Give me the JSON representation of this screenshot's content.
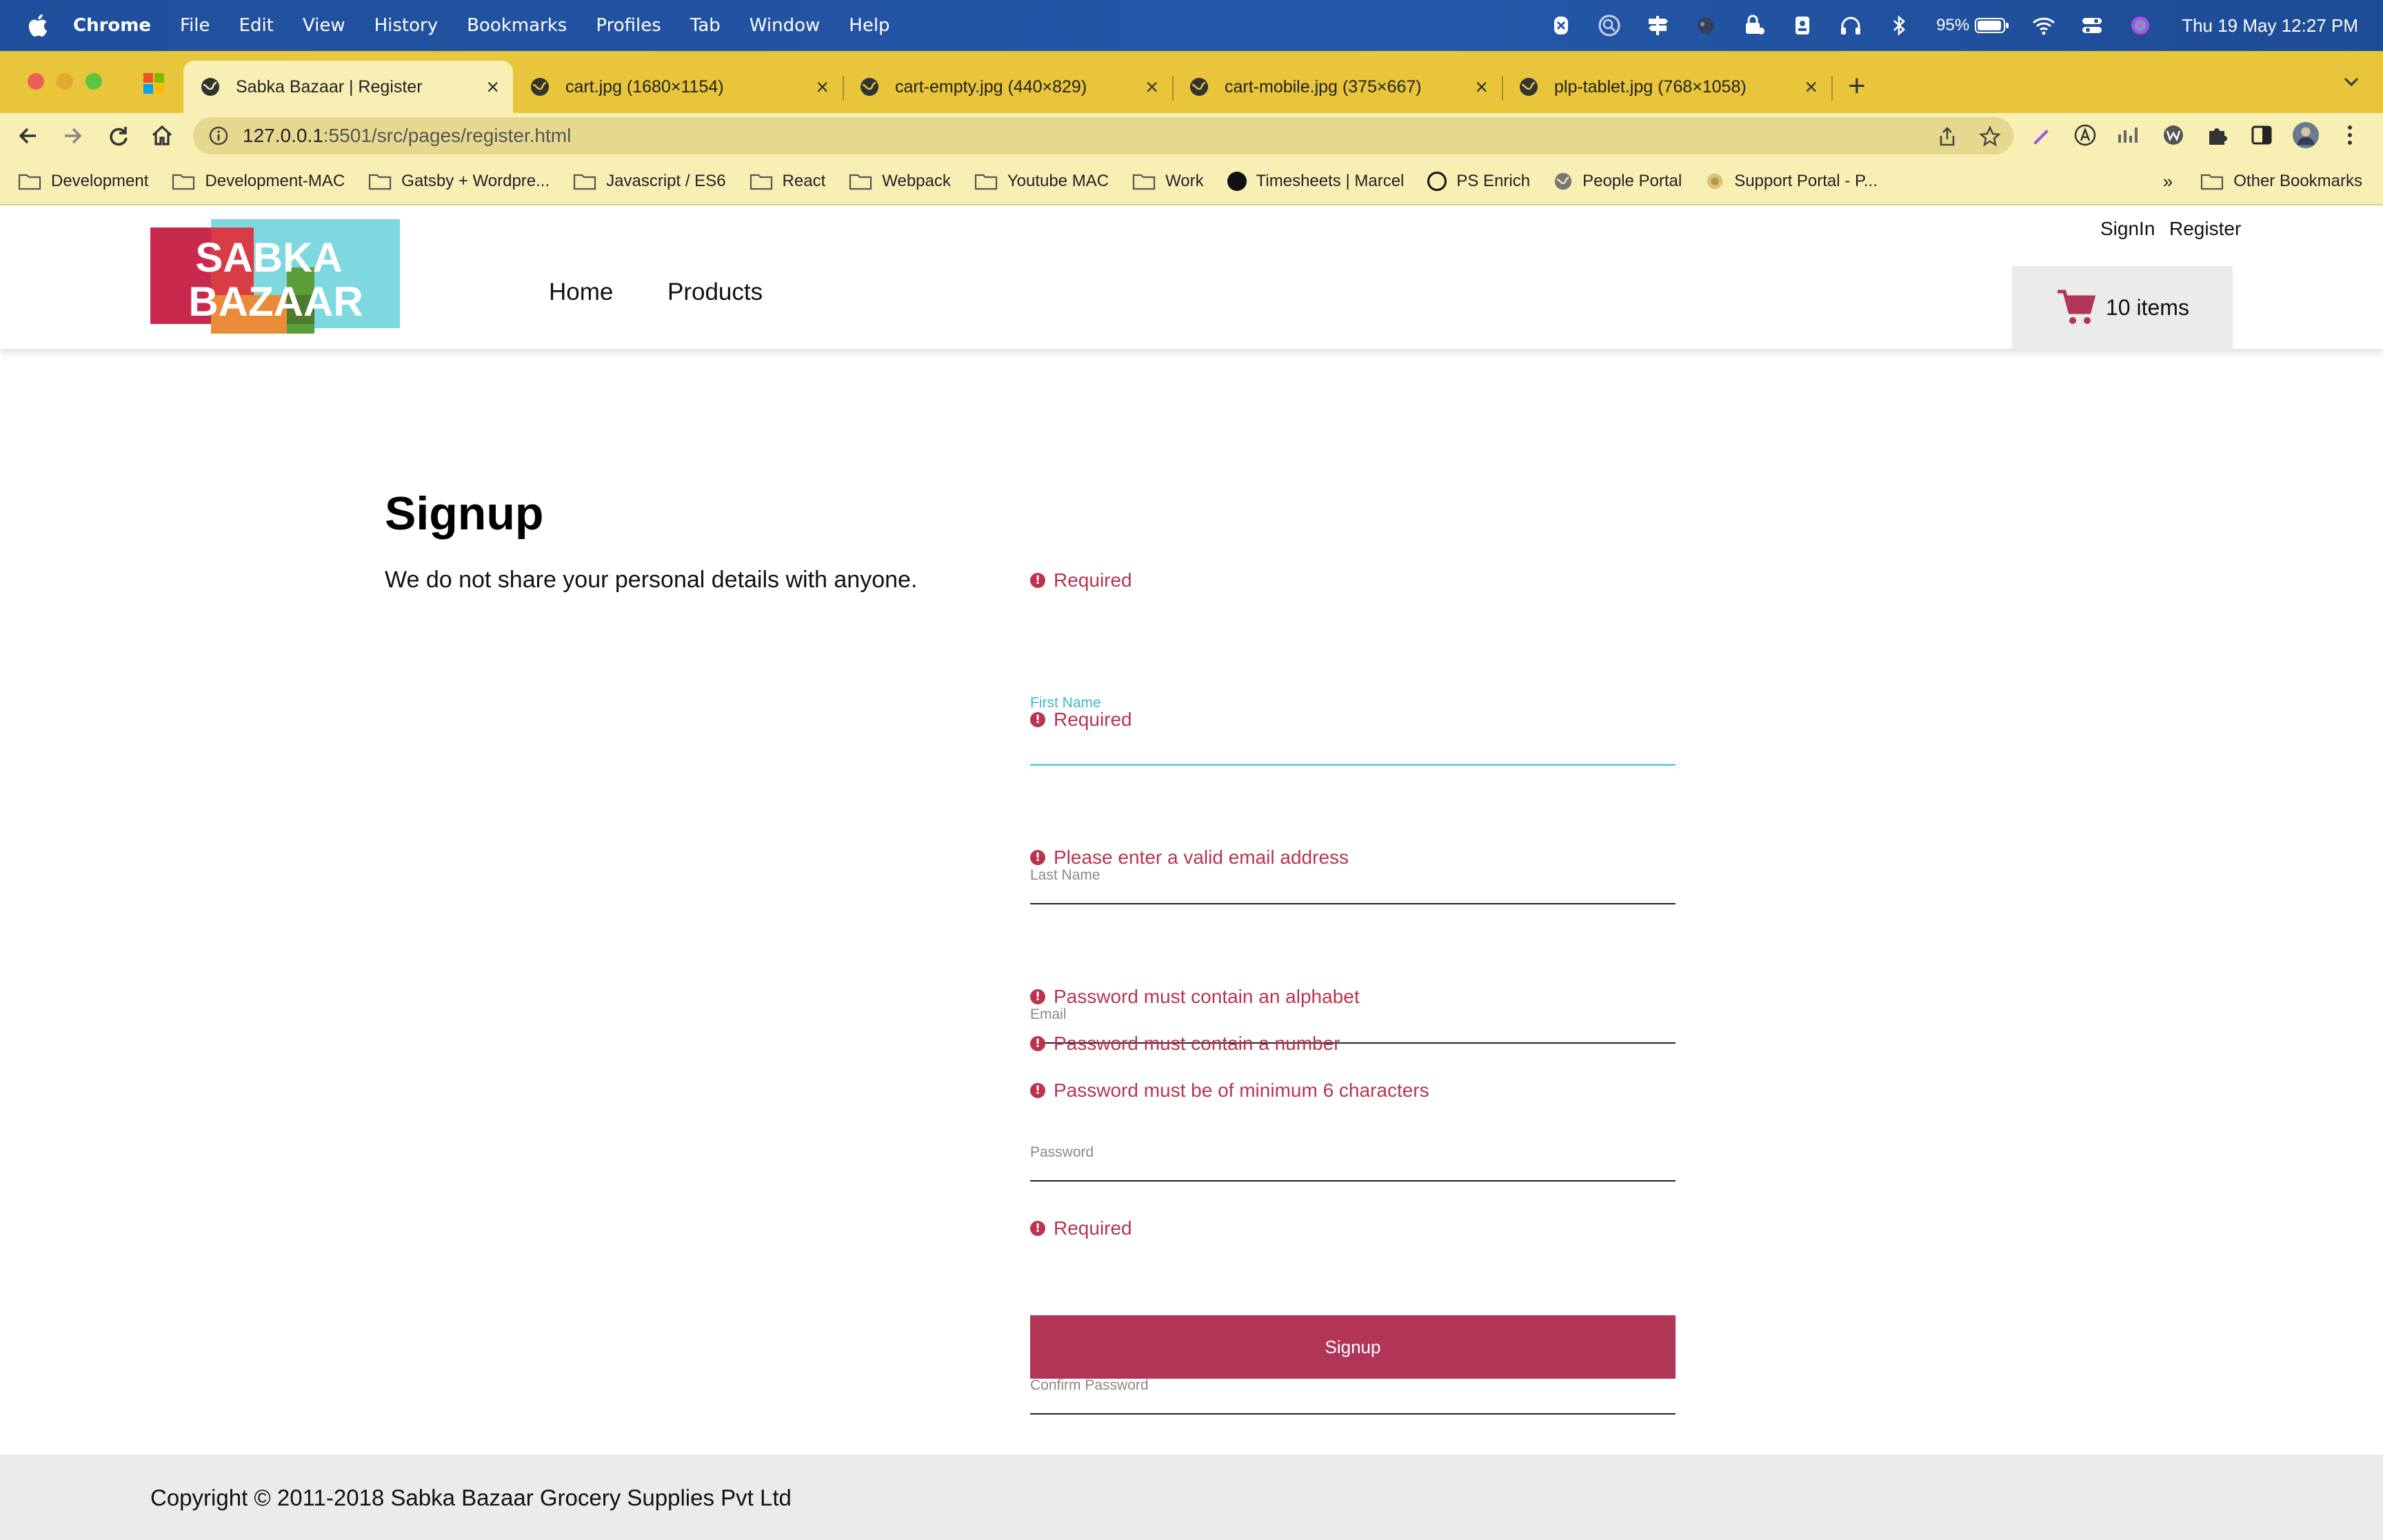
{
  "menubar": {
    "app_name": "Chrome",
    "items": [
      "File",
      "Edit",
      "View",
      "History",
      "Bookmarks",
      "Profiles",
      "Tab",
      "Window",
      "Help"
    ],
    "battery": "95%",
    "datetime": "Thu 19 May  12:27 PM"
  },
  "browser": {
    "tabs": [
      {
        "title": "Sabka Bazaar | Register",
        "active": true
      },
      {
        "title": "cart.jpg (1680×1154)",
        "active": false
      },
      {
        "title": "cart-empty.jpg (440×829)",
        "active": false
      },
      {
        "title": "cart-mobile.jpg (375×667)",
        "active": false
      },
      {
        "title": "plp-tablet.jpg (768×1058)",
        "active": false
      }
    ],
    "url_host": "127.0.0.1",
    "url_path": ":5501/src/pages/register.html",
    "bookmarks": [
      "Development",
      "Development-MAC",
      "Gatsby + Wordpre...",
      "Javascript / ES6",
      "React",
      "Webpack",
      "Youtube MAC",
      "Work",
      "Timesheets | Marcel",
      "PS Enrich",
      "People Portal",
      "Support Portal - P..."
    ],
    "bookmarks_more": "»",
    "other_bookmarks": "Other Bookmarks"
  },
  "site": {
    "logo_line1": "SABKA",
    "logo_line2": "BAZAAR",
    "nav": {
      "home": "Home",
      "products": "Products"
    },
    "signin": "SignIn",
    "register": "Register",
    "cart_label": "10 items",
    "brand_color": "#b13557",
    "focus_color": "#3bb8cf"
  },
  "signup": {
    "title": "Signup",
    "subtitle": "We do not share your personal details with anyone.",
    "fields": {
      "first_name": {
        "label": "First Name",
        "errors": [
          "Required"
        ]
      },
      "last_name": {
        "label": "Last Name",
        "errors": [
          "Required"
        ]
      },
      "email": {
        "label": "Email",
        "errors": [
          "Please enter a valid email address"
        ]
      },
      "password": {
        "label": "Password",
        "errors": [
          "Password must contain an alphabet",
          "Password must contain a number",
          "Password must be of minimum 6 characters"
        ]
      },
      "confirm_password": {
        "label": "Confirm Password",
        "errors": [
          "Required"
        ]
      }
    },
    "button": "Signup"
  },
  "footer": {
    "copyright": "Copyright © 2011-2018 Sabka Bazaar Grocery Supplies Pvt Ltd"
  }
}
